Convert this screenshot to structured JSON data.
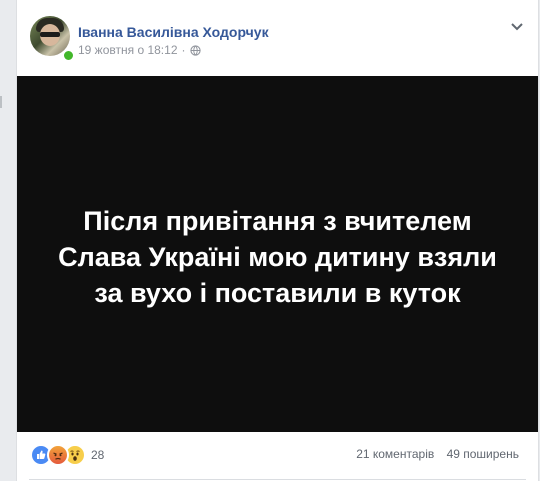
{
  "post": {
    "author": "Іванна Василівна Ходорчук",
    "date": "19 жовтня о 18:12",
    "separator": "·",
    "privacy_icon": "globe-icon",
    "options_icon": "chevron-down-icon",
    "image_text": "Після привітання з вчителем Слава Україні мою дитину взяли за вухо і поставили в куток",
    "reactions": {
      "icons": [
        "like-icon",
        "angry-icon",
        "wow-icon"
      ],
      "count": "28"
    },
    "comments": "21 коментарів",
    "shares": "49 поширень"
  },
  "colors": {
    "author": "#365899",
    "meta": "#90949c",
    "image_bg": "#0e0e0e",
    "online": "#42b72a"
  }
}
